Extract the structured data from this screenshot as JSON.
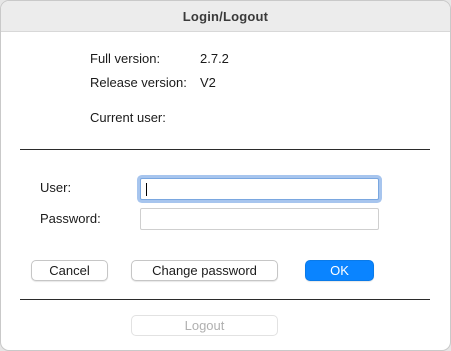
{
  "window": {
    "title": "Login/Logout"
  },
  "info": {
    "full_version_label": "Full version:",
    "full_version_value": "2.7.2",
    "release_version_label": "Release version:",
    "release_version_value": "V2",
    "current_user_label": "Current user:",
    "current_user_value": ""
  },
  "form": {
    "user_label": "User:",
    "user_value": "",
    "password_label": "Password:",
    "password_value": ""
  },
  "buttons": {
    "cancel": "Cancel",
    "change_password": "Change password",
    "ok": "OK",
    "logout": "Logout"
  },
  "colors": {
    "accent": "#0a84ff",
    "focus_ring": "#a7c5ee"
  }
}
